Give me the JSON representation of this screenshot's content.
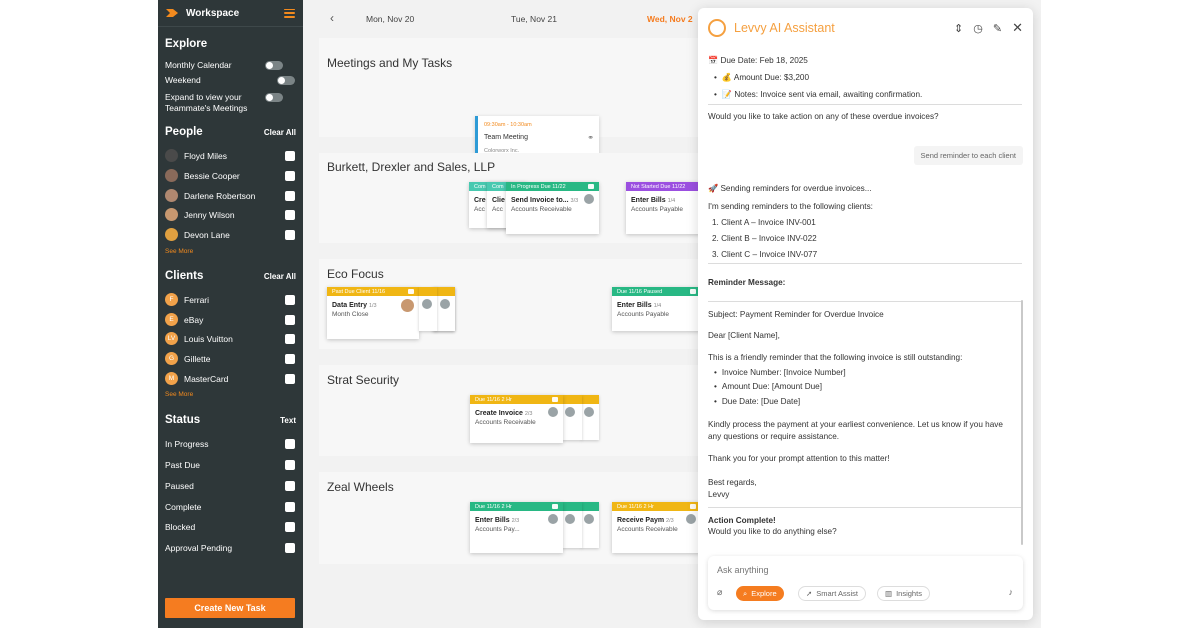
{
  "sidebar": {
    "workspace_title": "Workspace",
    "explore": {
      "title": "Explore",
      "toggles": [
        "Monthly Calendar",
        "Weekend"
      ],
      "expand_line1": "Expand to view your",
      "expand_line2": "Teammate's Meetings"
    },
    "people": {
      "title": "People",
      "clear": "Clear All",
      "items": [
        "Floyd Miles",
        "Bessie Cooper",
        "Darlene Robertson",
        "Jenny Wilson",
        "Devon Lane"
      ],
      "see_more": "See More"
    },
    "clients": {
      "title": "Clients",
      "clear": "Clear All",
      "items": [
        {
          "initial": "F",
          "name": "Ferrari"
        },
        {
          "initial": "E",
          "name": "eBay"
        },
        {
          "initial": "LV",
          "name": "Louis Vuitton"
        },
        {
          "initial": "G",
          "name": "Gillette"
        },
        {
          "initial": "M",
          "name": "MasterCard"
        }
      ],
      "see_more": "See More"
    },
    "status": {
      "title": "Status",
      "right": "Text",
      "items": [
        "In Progress",
        "Past Due",
        "Paused",
        "Complete",
        "Blocked",
        "Approval Pending"
      ]
    },
    "create_button": "Create New Task"
  },
  "dates": {
    "d1": "Mon, Nov 20",
    "d2": "Tue, Nov 21",
    "d3": "Wed, Nov 2"
  },
  "projects": {
    "meetings": {
      "title": "Meetings and My Tasks",
      "card_time": "09:30am - 10:30am",
      "card_title": "Team Meeting",
      "card_client": "Colorworx Inc."
    },
    "burkett": {
      "title": "Burkett, Drexler and Sales, LLP",
      "card1_hdr": "In Progress Due 11/22",
      "card1_title": "Send Invoice to...",
      "card1_num": "3/3",
      "card1_sub": "Accounts Receivable",
      "back1_title": "Cre",
      "back1_sub": "Acc",
      "back1_hdr": "Com",
      "back2_title": "Clie",
      "back2_sub": "Acc",
      "back2_hdr": "Com",
      "card2_hdr": "Not Started Due 11/22",
      "card2_title": "Enter Bills",
      "card2_num": "1/4",
      "card2_sub": "Accounts Payable"
    },
    "eco": {
      "title": "Eco Focus",
      "card1_hdr": "Past Due Client 11/16",
      "card1_title": "Data Entry",
      "card1_num": "1/3",
      "card1_sub": "Month Close",
      "card2_hdr": "Due 11/16 Paused",
      "card2_title": "Enter Bills",
      "card2_num": "1/4",
      "card2_sub": "Accounts Payable"
    },
    "strat": {
      "title": "Strat Security",
      "card1_hdr": "Due 11/16   2 Hr",
      "card1_title": "Create Invoice",
      "card1_num": "2/3",
      "card1_sub": "Accounts Receivable"
    },
    "zeal": {
      "title": "Zeal Wheels",
      "card1_hdr": "Due 11/16   2 Hr",
      "card1_title": "Enter Bills",
      "card1_num": "2/3",
      "card1_sub": "Accounts Pay...",
      "card2_hdr": "Due 11/16   2 Hr",
      "card2_title": "Receive Paym",
      "card2_num": "2/3",
      "card2_sub": "Accounts Receivable"
    }
  },
  "assistant": {
    "title": "Levvy AI Assistant",
    "due_date": "📅 Due Date: Feb 18, 2025",
    "amount": "💰 Amount Due: $3,200",
    "notes": "📝 Notes: Invoice sent via email, awaiting confirmation.",
    "question": "Would you like to take action on any of these overdue invoices?",
    "reply": "Send reminder to each client",
    "sending": "🚀 Sending reminders for overdue invoices...",
    "sending_to": "I'm sending reminders to the following clients:",
    "clients": [
      "1. Client A – Invoice INV-001",
      "2. Client B – Invoice INV-022",
      "3. Client C – Invoice INV-077"
    ],
    "reminder_label": "Reminder Message:",
    "subject": "Subject: Payment Reminder for Overdue Invoice",
    "dear": "Dear [Client Name],",
    "friendly": "This is a friendly reminder that the following invoice is still outstanding:",
    "fields": [
      "Invoice Number: [Invoice Number]",
      "Amount Due: [Amount Due]",
      "Due Date: [Due Date]"
    ],
    "kindly1": "Kindly process the payment at your earliest convenience. Let us know if you have",
    "kindly2": "any questions or require assistance.",
    "thanks": "Thank you for your prompt attention to this matter!",
    "regards": "Best regards,",
    "sign": "Levvy",
    "complete": "Action Complete!",
    "anything": "Would you like to do anything else?",
    "input_placeholder": "Ask anything",
    "pills": [
      "Explore",
      "Smart Assist",
      "Insights"
    ]
  },
  "colors": {
    "accent": "#f57c20",
    "sidebar_bg": "#2e3739",
    "green": "#28b884",
    "yellow": "#f0b614",
    "purple": "#9b4fe0",
    "teal": "#48c9b0"
  }
}
